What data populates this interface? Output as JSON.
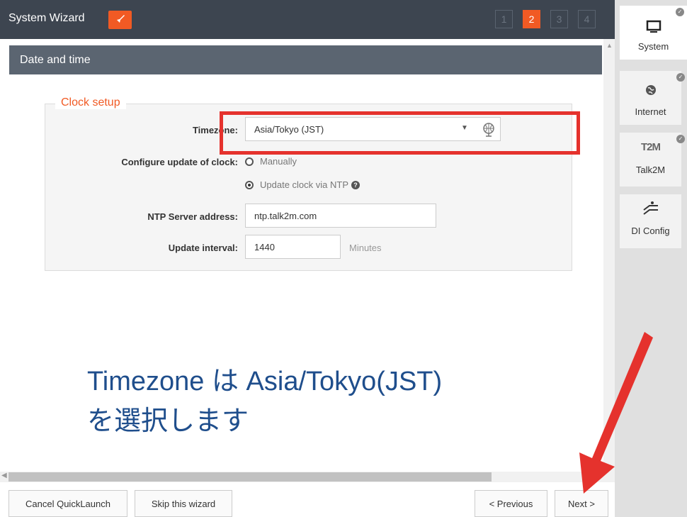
{
  "header": {
    "title": "System Wizard",
    "steps": [
      "1",
      "2",
      "3",
      "4"
    ],
    "active_step": 2
  },
  "section": {
    "title": "Date and time"
  },
  "clock": {
    "legend": "Clock setup",
    "timezone_label": "Timezone:",
    "timezone_value": "Asia/Tokyo (JST)",
    "update_label": "Configure update of clock:",
    "option_manual": "Manually",
    "option_ntp": "Update clock via NTP",
    "selected_option": "ntp",
    "ntp_label": "NTP Server address:",
    "ntp_value": "ntp.talk2m.com",
    "interval_label": "Update interval:",
    "interval_value": "1440",
    "interval_unit": "Minutes"
  },
  "annotation": {
    "text": "Timezone は Asia/Tokyo(JST)\nを選択します"
  },
  "footer": {
    "cancel": "Cancel QuickLaunch",
    "skip": "Skip this wizard",
    "previous": "< Previous",
    "next": "Next >"
  },
  "sidenav": {
    "items": [
      {
        "label": "System",
        "icon": "monitor-icon"
      },
      {
        "label": "Internet",
        "icon": "globe-icon"
      },
      {
        "label": "Talk2M",
        "icon": "t2m-icon",
        "icon_text": "T2M"
      },
      {
        "label": "DI Config",
        "icon": "switches-icon"
      }
    ]
  },
  "colors": {
    "accent": "#f15a24",
    "header_bg": "#3d4550",
    "highlight": "#e5322d",
    "annotation_text": "#1f4e8c"
  }
}
